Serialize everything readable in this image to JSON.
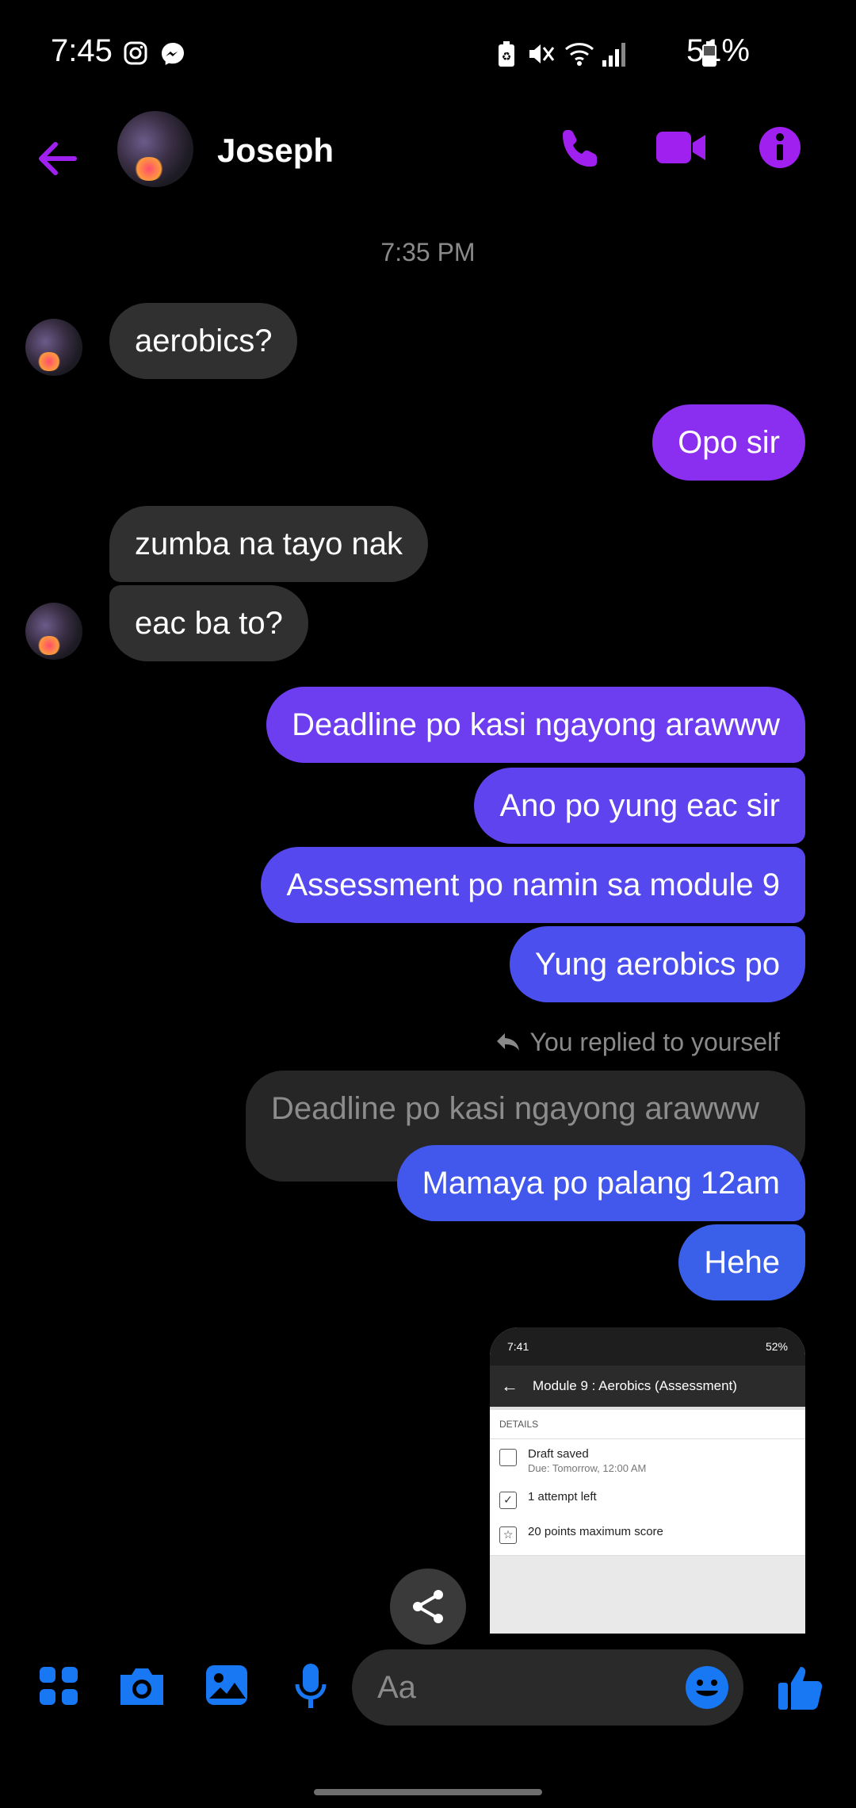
{
  "status_bar": {
    "time": "7:45",
    "battery_pct": "51%"
  },
  "header": {
    "contact_name": "Joseph"
  },
  "timestamp": "7:35 PM",
  "messages": {
    "m1": "aerobics?",
    "m2": "Opo sir",
    "m3": "zumba na tayo nak",
    "m4": "eac ba to?",
    "m5": "Deadline po kasi ngayong arawww",
    "m6": "Ano po yung eac sir",
    "m7": "Assessment po namin sa module 9",
    "m8": "Yung aerobics po",
    "reply_label": "You replied to yourself",
    "quoted": "Deadline po kasi ngayong arawww",
    "m9": "Mamaya po palang 12am",
    "m10": "Hehe"
  },
  "attachment": {
    "status_time": "7:41",
    "status_batt": "52%",
    "title": "Module 9 : Aerobics (Assessment)",
    "section": "DETAILS",
    "draft": "Draft saved",
    "due": "Due: Tomorrow, 12:00 AM",
    "attempts": "1 attempt left",
    "points": "20 points maximum score"
  },
  "composer": {
    "placeholder": "Aa"
  },
  "colors": {
    "accent_purple": "#a020f0",
    "bubble_out_1": "#6d3df0",
    "bubble_out_2": "#5b43ee",
    "bubble_out_3": "#4a55ec",
    "bubble_out_4": "#3e62ea",
    "blue_icon": "#1877f2"
  }
}
